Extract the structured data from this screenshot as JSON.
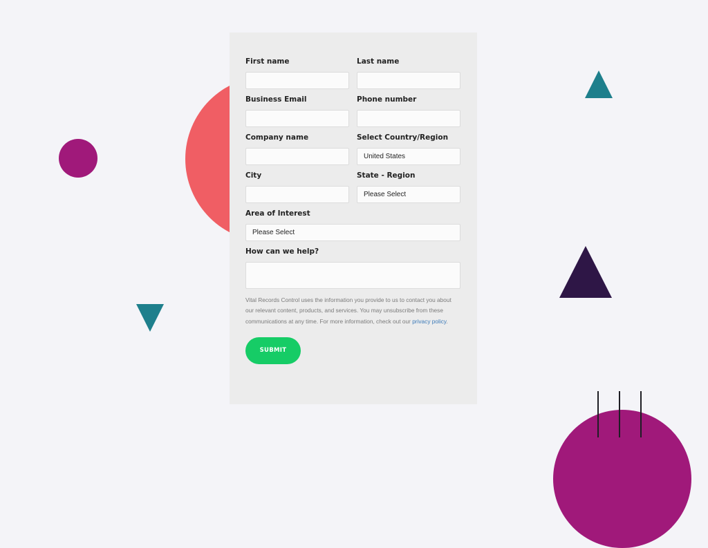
{
  "colors": {
    "background": "#f4f4f8",
    "card": "#ececec",
    "coral": "#f05e64",
    "magenta": "#a0197a",
    "teal": "#1e7f8c",
    "dark_purple": "#2e1646",
    "submit_green": "#16cc66"
  },
  "form": {
    "first_name": {
      "label": "First name",
      "value": ""
    },
    "last_name": {
      "label": "Last name",
      "value": ""
    },
    "business_email": {
      "label": "Business Email",
      "value": ""
    },
    "phone_number": {
      "label": "Phone number",
      "value": ""
    },
    "company_name": {
      "label": "Company name",
      "value": ""
    },
    "country": {
      "label": "Select Country/Region",
      "value": "United States"
    },
    "city": {
      "label": "City",
      "value": ""
    },
    "state": {
      "label": "State - Region",
      "value": "Please Select"
    },
    "area_of_interest": {
      "label": "Area of Interest",
      "value": "Please Select"
    },
    "help": {
      "label": "How can we help?",
      "value": ""
    },
    "disclaimer_text": "Vital Records Control uses the information you provide to us to contact you about our relevant content, products, and services. You may unsubscribe from these communications at any time. For more information, check out our",
    "privacy_link": "privacy policy",
    "disclaimer_end": ".",
    "submit_label": "SUBMIT"
  }
}
